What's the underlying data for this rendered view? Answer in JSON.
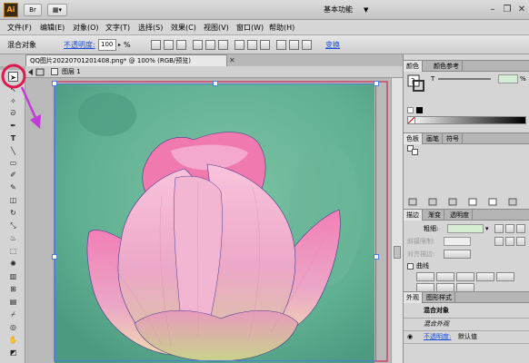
{
  "app": {
    "logo_text": "Ai",
    "workspace_label": "基本功能"
  },
  "menu": {
    "items": [
      "文件(F)",
      "编辑(E)",
      "对象(O)",
      "文字(T)",
      "选择(S)",
      "效果(C)",
      "视图(V)",
      "窗口(W)",
      "帮助(H)"
    ]
  },
  "control_bar": {
    "object_label": "混合对象",
    "opacity_label": "不透明度:",
    "opacity_value": "100",
    "opacity_unit": "%",
    "transform_label": "变换"
  },
  "document": {
    "tab_title": "QQ图片20220701201408.png* @ 100% (RGB/预览)",
    "layer_label": "图层 1"
  },
  "panels": {
    "color_tabs": [
      "颜色",
      "颜色参考"
    ],
    "color_channel": "T",
    "color_unit": "%",
    "swatch_tabs": [
      "色板",
      "画笔",
      "符号"
    ],
    "stroke_tabs": [
      "描边",
      "渐变",
      "透明度"
    ],
    "stroke_weight_label": "粗细:",
    "stroke_faded_labels": [
      "斜接限制:",
      "对齐描边:"
    ],
    "curve_label": "曲线",
    "appearance_tabs": [
      "外观",
      "图形样式"
    ],
    "appearance_title": "混合对象",
    "appearance_subtitle": "混合外观",
    "opacity_link": "不透明度:",
    "opacity_value": "默认值"
  },
  "colors": {
    "highlight_circle": "#e0184c",
    "arrow": "#c23bd8",
    "artboard_border": "#d0284f",
    "lotus_pink": "#ea86b4",
    "leaf_green": "#6db79a",
    "link_blue": "#1d4fd8"
  },
  "icons": [
    "selection-tool-icon",
    "direct-selection-icon",
    "magic-wand-icon",
    "lasso-icon",
    "pen-icon",
    "type-icon",
    "line-icon",
    "rectangle-icon",
    "paintbrush-icon",
    "pencil-icon",
    "eraser-icon",
    "rotate-icon",
    "scale-icon",
    "warp-icon",
    "free-transform-icon",
    "symbol-sprayer-icon",
    "graph-icon",
    "mesh-icon",
    "gradient-icon",
    "eyedropper-icon",
    "blend-icon",
    "slice-icon",
    "hand-icon",
    "zoom-icon",
    "fill-stroke-icon",
    "screen-mode-icon"
  ]
}
